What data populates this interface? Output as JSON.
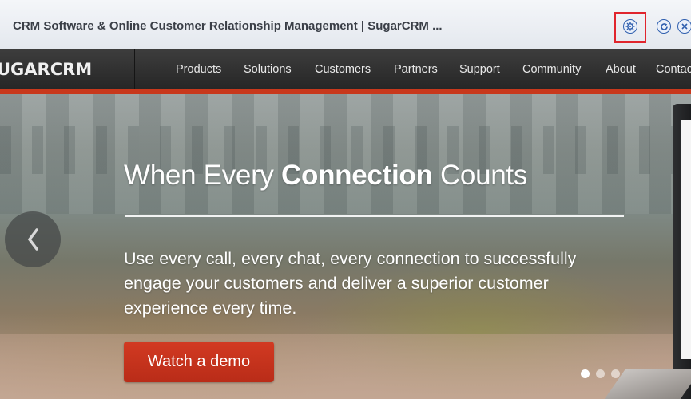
{
  "window": {
    "title": "CRM Software & Online Customer Relationship Management | SugarCRM ...",
    "buttons": [
      {
        "name": "settings",
        "icon": "gear-icon",
        "highlighted": true
      },
      {
        "name": "refresh",
        "icon": "refresh-icon"
      },
      {
        "name": "close",
        "icon": "close-icon"
      }
    ],
    "highlight_color": "#e0252d"
  },
  "site": {
    "logo": "UGARCRM",
    "nav": [
      "Products",
      "Solutions",
      "Customers",
      "Partners",
      "Support",
      "Community",
      "About",
      "Contac"
    ],
    "accent": "#c8381c"
  },
  "hero": {
    "headline_pre": "When Every ",
    "headline_bold": "Connection",
    "headline_post": " Counts",
    "paragraph": "Use every call, every chat, every connection to successfully engage your customers and deliver a superior customer experience every time.",
    "cta": "Watch a demo",
    "prev_icon": "chevron-left-icon",
    "carousel": {
      "slides": 3,
      "active": 1
    }
  }
}
